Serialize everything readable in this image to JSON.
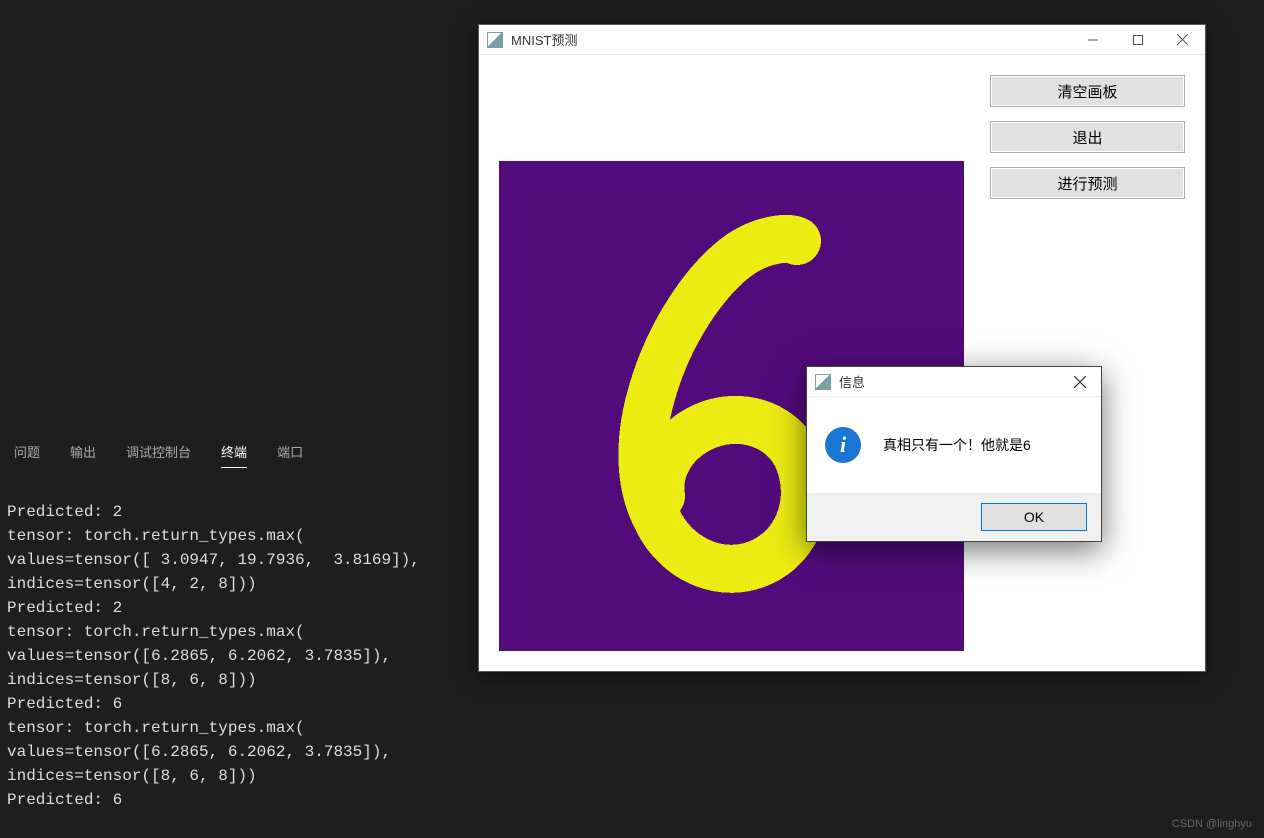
{
  "terminal": {
    "tabs": [
      "问题",
      "输出",
      "调试控制台",
      "终端",
      "端口"
    ],
    "active_tab_index": 3,
    "output": "Predicted: 2\ntensor: torch.return_types.max(\nvalues=tensor([ 3.0947, 19.7936,  3.8169]),\nindices=tensor([4, 2, 8]))\nPredicted: 2\ntensor: torch.return_types.max(\nvalues=tensor([6.2865, 6.2062, 3.7835]),\nindices=tensor([8, 6, 8]))\nPredicted: 6\ntensor: torch.return_types.max(\nvalues=tensor([6.2865, 6.2062, 3.7835]),\nindices=tensor([8, 6, 8]))\nPredicted: 6"
  },
  "app": {
    "title": "MNIST预测",
    "buttons": {
      "clear": "清空画板",
      "exit": "退出",
      "predict": "进行预测"
    },
    "canvas": {
      "bg_color": "#520b7b",
      "stroke_color": "#ebec11",
      "drawn_digit": "6"
    }
  },
  "msgbox": {
    "title": "信息",
    "text": "真相只有一个！他就是6",
    "ok": "OK"
  },
  "watermark": "CSDN @linghyu"
}
